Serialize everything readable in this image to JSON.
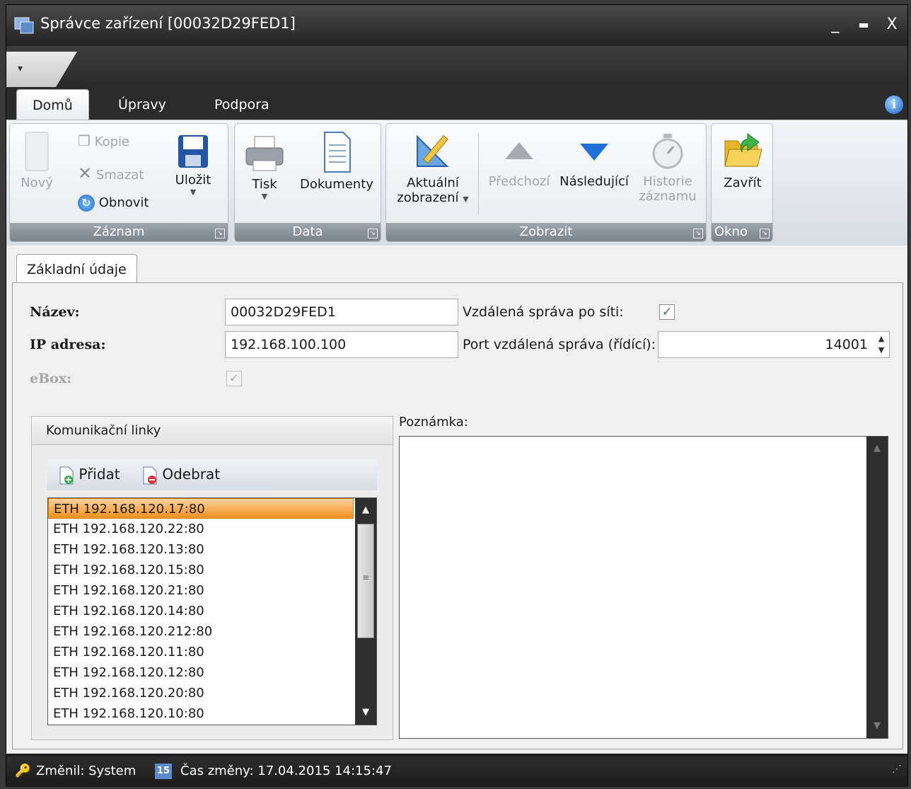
{
  "window": {
    "title": "Správce zařízení [00032D29FED1]",
    "controls": {
      "minimize": "_",
      "maximize": "▬",
      "close": "X"
    }
  },
  "tabs": [
    {
      "label": "Domů",
      "active": true
    },
    {
      "label": "Úpravy",
      "active": false
    },
    {
      "label": "Podpora",
      "active": false
    }
  ],
  "ribbon": {
    "zaznam": {
      "label": "Záznam",
      "novy": "Nový",
      "kopie": "Kopie",
      "smazat": "Smazat",
      "obnovit": "Obnovit",
      "ulozit": "Uložit"
    },
    "data": {
      "label": "Data",
      "tisk": "Tisk",
      "dokumenty": "Dokumenty"
    },
    "zobrazit": {
      "label": "Zobrazit",
      "aktualni_1": "Aktuální",
      "aktualni_2": "zobrazení",
      "predchozi": "Předchozí",
      "nasledujici": "Následující",
      "historie_1": "Historie",
      "historie_2": "záznamu"
    },
    "okno": {
      "label": "Okno",
      "zavrit": "Zavřít"
    }
  },
  "content_tab": "Základní údaje",
  "form": {
    "nazev_label": "Název:",
    "nazev_value": "00032D29FED1",
    "ip_label": "IP adresa:",
    "ip_value": "192.168.100.100",
    "ebox_label": "eBox:",
    "ebox_checked": true,
    "remote_label": "Vzdálená správa po síti:",
    "remote_checked": true,
    "port_label": "Port vzdálená správa (řídící):",
    "port_value": "14001"
  },
  "links": {
    "title": "Komunikační linky",
    "add": "Přidat",
    "remove": "Odebrat",
    "items": [
      "ETH 192.168.120.17:80",
      "ETH 192.168.120.22:80",
      "ETH 192.168.120.13:80",
      "ETH 192.168.120.15:80",
      "ETH 192.168.120.21:80",
      "ETH 192.168.120.14:80",
      "ETH 192.168.120.212:80",
      "ETH 192.168.120.11:80",
      "ETH 192.168.120.12:80",
      "ETH 192.168.120.20:80",
      "ETH 192.168.120.10:80"
    ],
    "selected_index": 0
  },
  "note": {
    "label": "Poznámka:",
    "value": ""
  },
  "status": {
    "changed_by": "Změnil: System",
    "changed_at": "Čas změny: 17.04.2015 14:15:47"
  },
  "colors": {
    "selection": "#f1901f",
    "accent_blue": "#1a64c8"
  },
  "icons": [
    "app-icon",
    "qat-dropdown-icon",
    "info-icon",
    "new-doc-icon",
    "copy-icon",
    "delete-icon",
    "refresh-icon",
    "save-icon",
    "printer-icon",
    "document-icon",
    "view-icon",
    "up-arrow-icon",
    "down-arrow-icon",
    "history-icon",
    "close-folder-icon",
    "add-doc-icon",
    "remove-doc-icon",
    "user-icon",
    "schedule-icon"
  ]
}
